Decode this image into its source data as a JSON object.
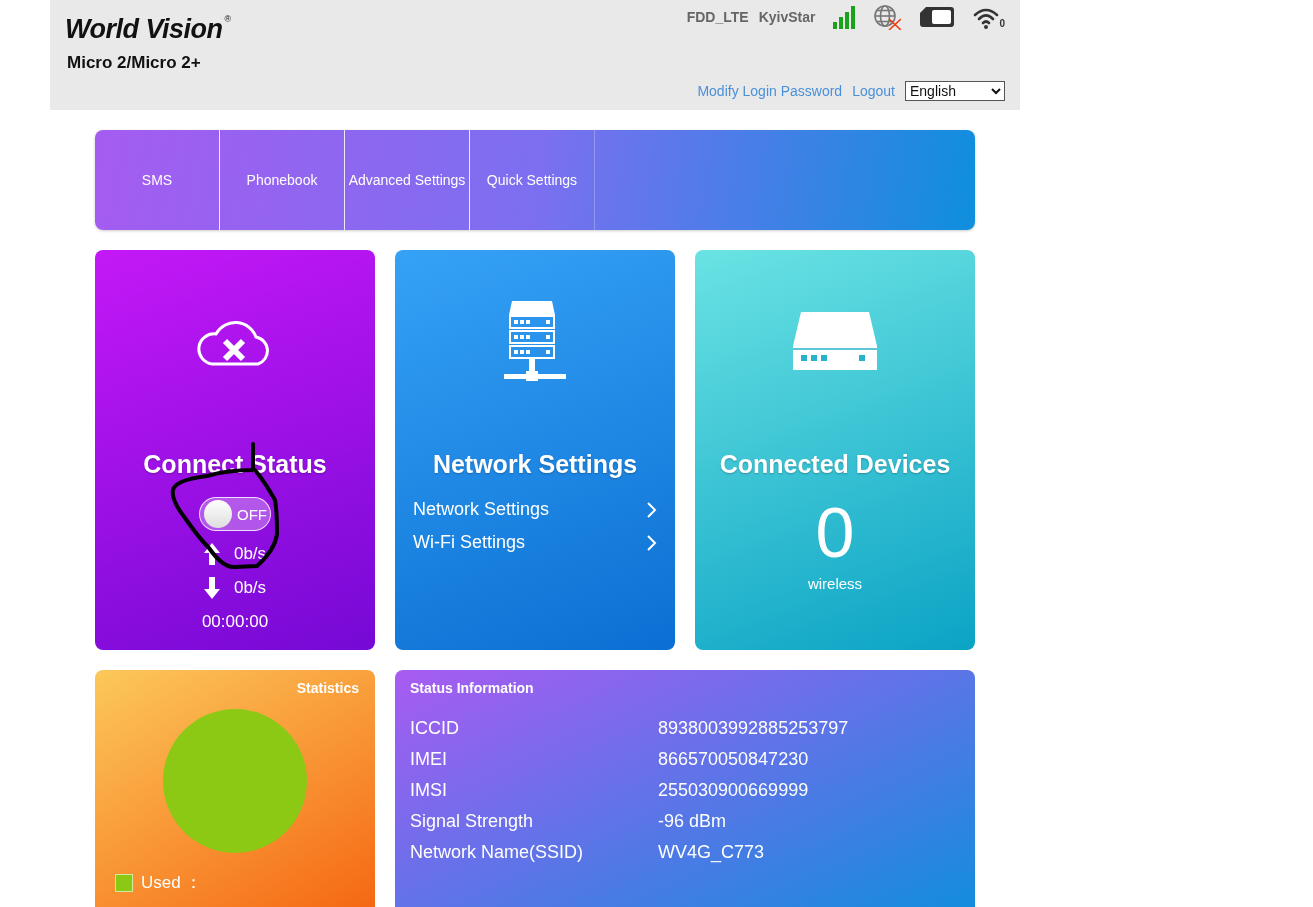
{
  "header": {
    "brand": "World Vision",
    "brand_mark": "®",
    "model": "Micro 2/Micro 2+",
    "network_type": "FDD_LTE",
    "operator": "KyivStar",
    "wifi_clients": "0",
    "links": [
      {
        "label": "Modify Login Password"
      },
      {
        "label": "Logout"
      }
    ],
    "language": {
      "value": "English"
    }
  },
  "tabs": [
    {
      "label": "SMS",
      "selected": false
    },
    {
      "label": "Phonebook",
      "selected": false
    },
    {
      "label": "Advanced Settings",
      "selected": false
    },
    {
      "label": "Quick Settings",
      "selected": false
    }
  ],
  "connect_card": {
    "title": "Connect Status",
    "switch": {
      "on": false,
      "label": "OFF"
    },
    "upload": "0b/s",
    "download": "0b/s",
    "duration": "00:00:00"
  },
  "network_card": {
    "title": "Network Settings",
    "links": [
      {
        "label": "Network Settings"
      },
      {
        "label": "Wi-Fi Settings"
      }
    ]
  },
  "devices_card": {
    "title": "Connected Devices",
    "count": "0",
    "caption": "wireless"
  },
  "statistics": {
    "title": "Statistics",
    "legend": [
      {
        "label": "Used ：",
        "color": "#8cc914"
      }
    ]
  },
  "status_information": {
    "title": "Status Information",
    "rows": [
      {
        "label": "ICCID",
        "value": "8938003992885253797"
      },
      {
        "label": "IMEI",
        "value": "866570050847230"
      },
      {
        "label": "IMSI",
        "value": "255030900669999"
      },
      {
        "label": "Signal Strength",
        "value": "-96 dBm"
      },
      {
        "label": "Network Name(SSID)",
        "value": "WV4G_C773"
      }
    ]
  }
}
